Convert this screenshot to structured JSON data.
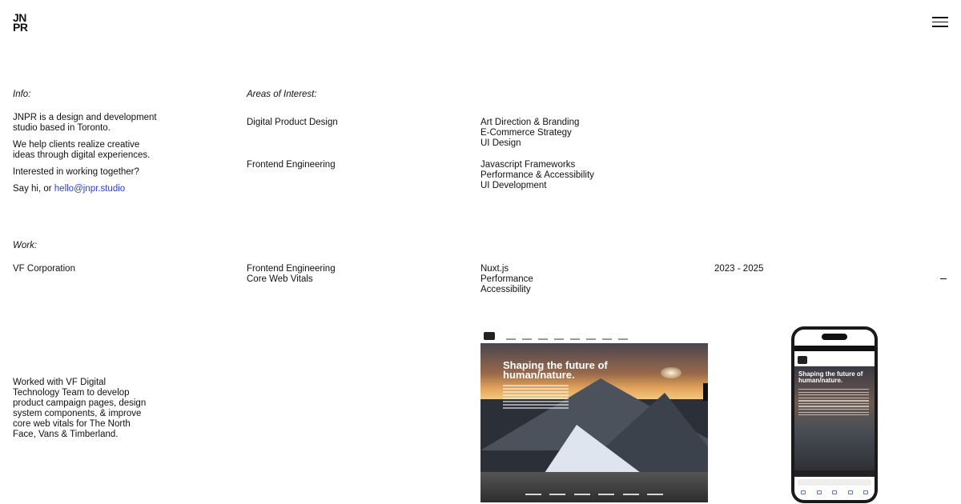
{
  "brand": {
    "logo_line1": "JN",
    "logo_line2": "PR"
  },
  "header": {
    "menu_icon": "hamburger-icon"
  },
  "info": {
    "label": "Info:",
    "p1": "JNPR is a design and development studio based in Toronto.",
    "p2": "We help clients realize creative ideas through digital experiences.",
    "p3": "Interested in working together?",
    "p4_prefix": "Say hi, or ",
    "email": "hello@jnpr.studio"
  },
  "areas": {
    "label": "Areas of Interest:",
    "groups": [
      {
        "title": "Digital Product Design",
        "items": [
          "Art Direction & Branding",
          "E-Commerce Strategy",
          "UI Design"
        ]
      },
      {
        "title": "Frontend Engineering",
        "items": [
          "Javascript Frameworks",
          "Performance & Accessibility",
          "UI Development"
        ]
      }
    ]
  },
  "work": {
    "label": "Work:",
    "client": "VF Corporation",
    "roles": [
      "Frontend Engineering",
      "Core Web Vitals"
    ],
    "tech": [
      "Nuxt.js",
      "Performance",
      "Accessibility"
    ],
    "years": "2023 - 2025",
    "collapse_icon": "minus-icon",
    "description": "Worked with VF Digital Technology Team to develop product campaign pages, design system components, & improve core web vitals for The North Face, Vans & Timberland.",
    "desktop_headline": "Shaping the future of human/nature.",
    "mobile_headline": "Shaping the future of human/nature."
  }
}
